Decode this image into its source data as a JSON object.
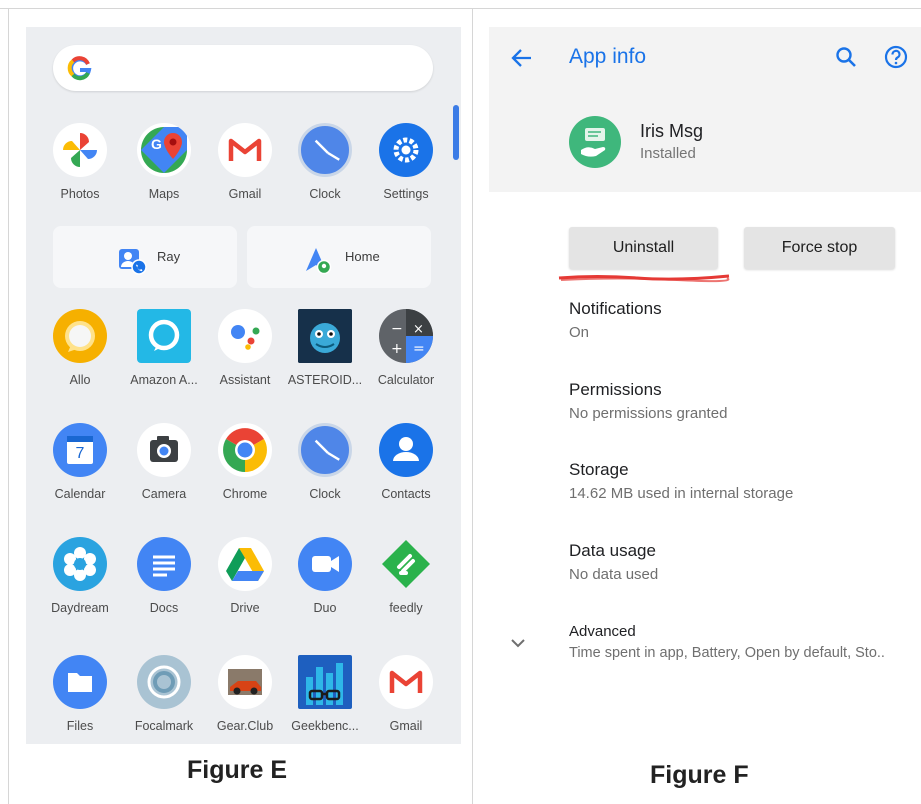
{
  "figure_e": {
    "caption": "Figure E",
    "favorites": [
      {
        "label": "Photos",
        "icon": "photos-icon"
      },
      {
        "label": "Maps",
        "icon": "maps-icon"
      },
      {
        "label": "Gmail",
        "icon": "gmail-icon"
      },
      {
        "label": "Clock",
        "icon": "clock-icon"
      },
      {
        "label": "Settings",
        "icon": "settings-icon"
      }
    ],
    "shortcuts": [
      {
        "label": "Ray",
        "icon": "contact-icon"
      },
      {
        "label": "Home",
        "icon": "maps-directions-icon"
      }
    ],
    "apps_row1": [
      {
        "label": "Allo"
      },
      {
        "label": "Amazon A..."
      },
      {
        "label": "Assistant"
      },
      {
        "label": "ASTEROID..."
      },
      {
        "label": "Calculator"
      }
    ],
    "apps_row2": [
      {
        "label": "Calendar",
        "day": "7"
      },
      {
        "label": "Camera"
      },
      {
        "label": "Chrome"
      },
      {
        "label": "Clock"
      },
      {
        "label": "Contacts"
      }
    ],
    "apps_row3": [
      {
        "label": "Daydream"
      },
      {
        "label": "Docs"
      },
      {
        "label": "Drive"
      },
      {
        "label": "Duo"
      },
      {
        "label": "feedly"
      }
    ],
    "apps_row4": [
      {
        "label": "Files"
      },
      {
        "label": "Focalmark"
      },
      {
        "label": "Gear.Club"
      },
      {
        "label": "Geekbenc..."
      },
      {
        "label": "Gmail"
      }
    ]
  },
  "figure_f": {
    "caption": "Figure F",
    "header": {
      "title": "App info"
    },
    "app": {
      "name": "Iris Msg",
      "status": "Installed"
    },
    "buttons": {
      "uninstall": "Uninstall",
      "force_stop": "Force stop"
    },
    "settings": [
      {
        "title": "Notifications",
        "subtitle": "On"
      },
      {
        "title": "Permissions",
        "subtitle": "No permissions granted"
      },
      {
        "title": "Storage",
        "subtitle": "14.62 MB used in internal storage"
      },
      {
        "title": "Data usage",
        "subtitle": "No data used"
      },
      {
        "title": "Advanced",
        "subtitle": "Time spent in app, Battery, Open by default, Sto.."
      }
    ],
    "colors": {
      "accent": "#1a73e8",
      "app_icon": "#3fb77c",
      "underline": "#e53935"
    }
  }
}
